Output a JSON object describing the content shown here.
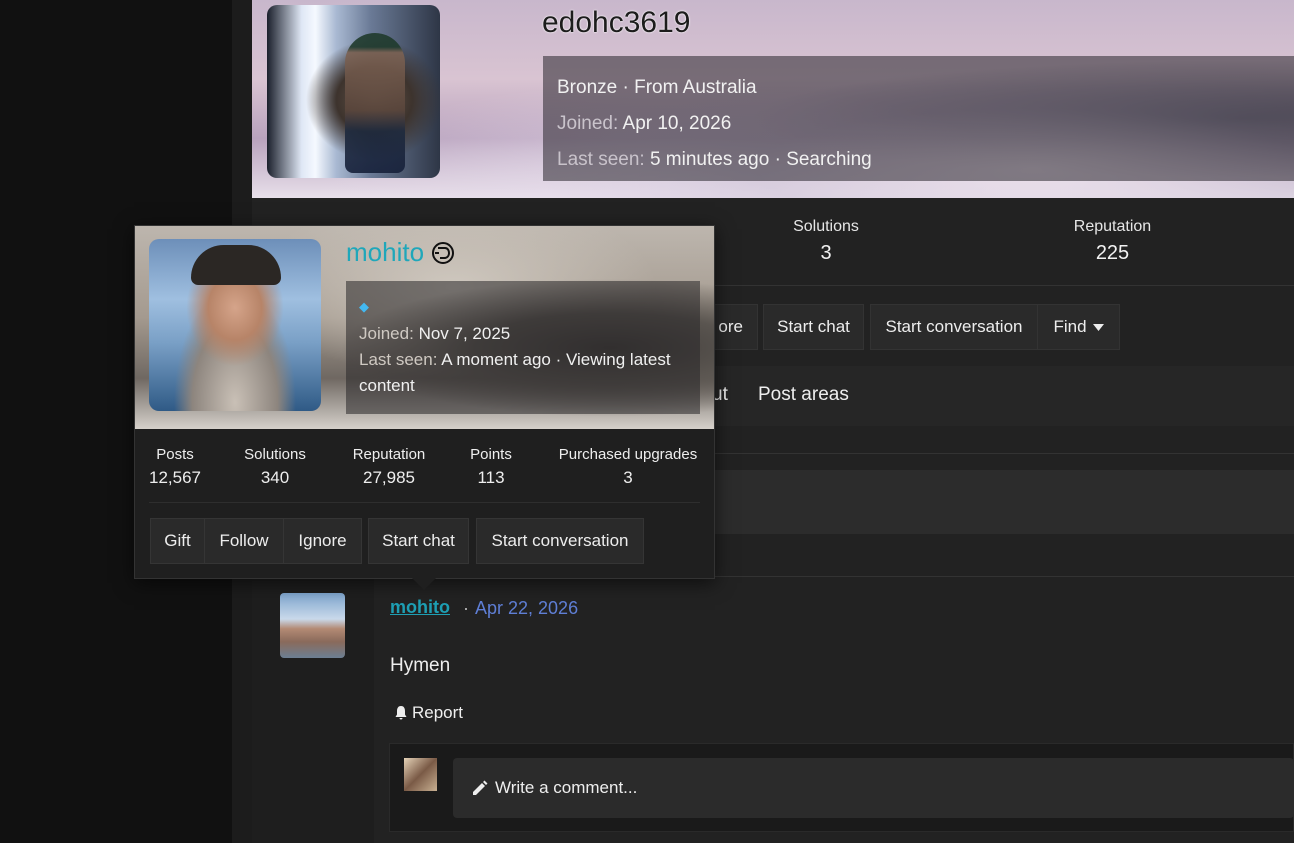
{
  "profile": {
    "username": "edohc3619",
    "rank_line": "Bronze · From Australia",
    "joined_label": "Joined:",
    "joined_value": "Apr 10, 2026",
    "last_seen_label": "Last seen:",
    "last_seen_value": "5 minutes ago · Searching",
    "stats": [
      {
        "label": "Solutions",
        "value": "3"
      },
      {
        "label": "Reputation",
        "value": "225"
      }
    ],
    "buttons": {
      "more_partial": "ore",
      "start_chat": "Start chat",
      "start_conversation": "Start conversation",
      "find": "Find"
    },
    "tabs": {
      "partial": "ut",
      "post_areas": "Post areas"
    }
  },
  "hover_card": {
    "username": "mohito",
    "joined_label": "Joined:",
    "joined_value": "Nov 7, 2025",
    "last_seen_label": "Last seen:",
    "last_seen_value": "A moment ago · Viewing latest content",
    "stats": [
      {
        "label": "Posts",
        "value": "12,567"
      },
      {
        "label": "Solutions",
        "value": "340"
      },
      {
        "label": "Reputation",
        "value": "27,985"
      },
      {
        "label": "Points",
        "value": "113"
      },
      {
        "label": "Purchased upgrades",
        "value": "3"
      }
    ],
    "buttons": {
      "gift": "Gift",
      "follow": "Follow",
      "ignore": "Ignore",
      "start_chat": "Start chat",
      "start_conversation": "Start conversation"
    }
  },
  "post": {
    "author": "mohito",
    "separator": "·",
    "date": "Apr 22, 2026",
    "body": "Hymen",
    "report_label": "Report",
    "comment_placeholder": "Write a comment..."
  }
}
